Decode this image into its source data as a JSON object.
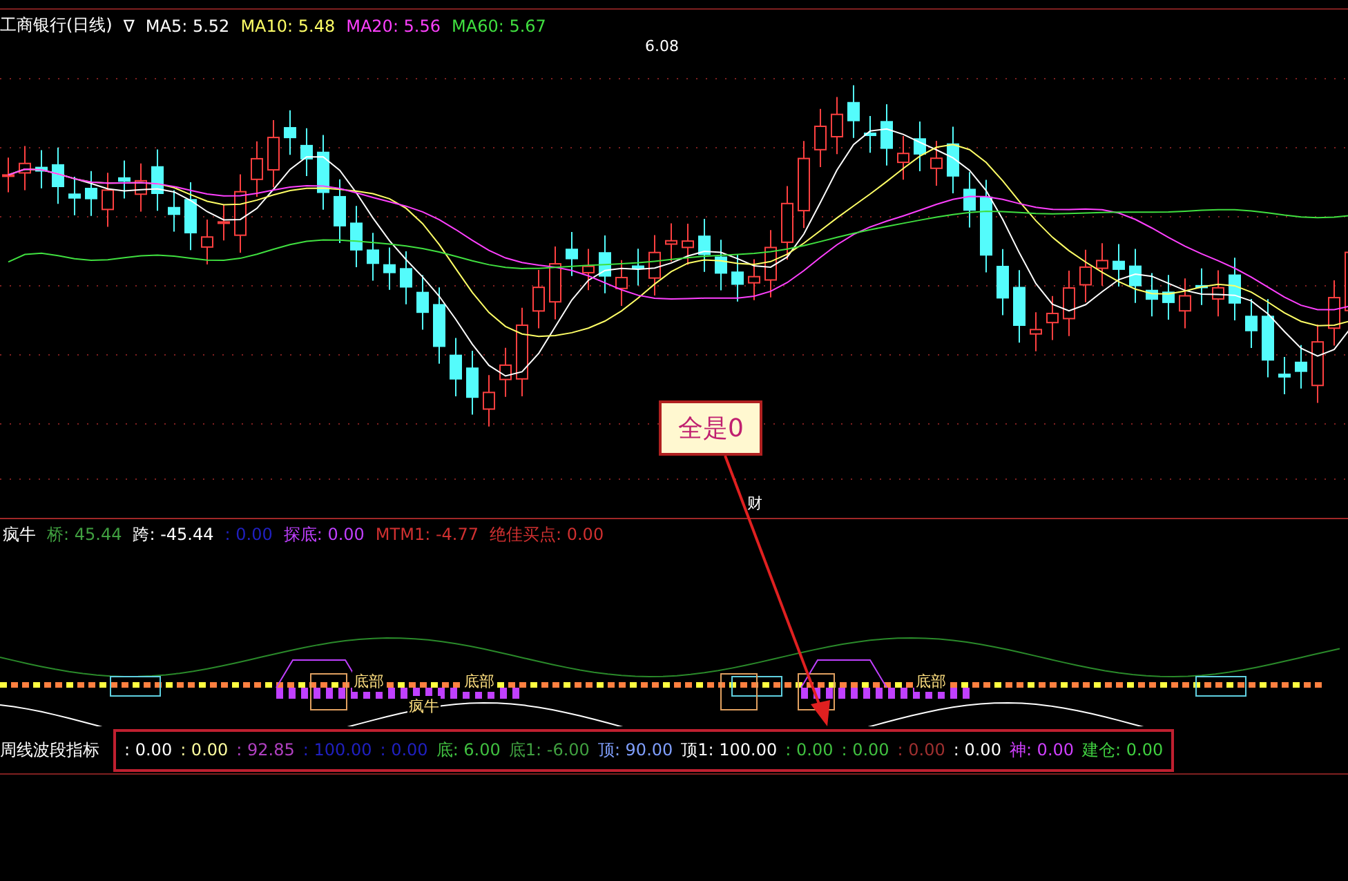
{
  "main_chart": {
    "title": "工商银行(日线)",
    "toggle": "∇",
    "legend": [
      {
        "text": "MA5: 5.52",
        "color": "#ffffff"
      },
      {
        "text": "MA10: 5.48",
        "color": "#ffff66"
      },
      {
        "text": "MA20: 5.56",
        "color": "#ff40ff"
      },
      {
        "text": "MA60: 5.67",
        "color": "#40e040"
      }
    ],
    "peak_label": "6.08",
    "event_marker": "财"
  },
  "callout": {
    "text": "全是0"
  },
  "indicator_1": {
    "title": "疯牛",
    "items": [
      {
        "text": "桥: 45.44",
        "color": "#40a040"
      },
      {
        "text": "跨: -45.44",
        "color": "#ffffff"
      },
      {
        "text": ": 0.00",
        "color": "#2020c0"
      },
      {
        "text": "探底: 0.00",
        "color": "#c040ff"
      },
      {
        "text": "MTM1: -4.77",
        "color": "#d03030"
      },
      {
        "text": "绝佳买点: 0.00",
        "color": "#d03030"
      }
    ],
    "labels": [
      "底部",
      "底部",
      "疯牛",
      "底部"
    ]
  },
  "indicator_2": {
    "title": "周线波段指标",
    "items": [
      {
        "text": ": 0.00",
        "color": "#ffffff"
      },
      {
        "text": ": 0.00",
        "color": "#ffffa0"
      },
      {
        "text": ": 92.85",
        "color": "#b040c0"
      },
      {
        "text": ": 100.00",
        "color": "#2020c0"
      },
      {
        "text": ": 0.00",
        "color": "#2020c0"
      },
      {
        "text": "底: 6.00",
        "color": "#40c040"
      },
      {
        "text": "底1: -6.00",
        "color": "#40a040"
      },
      {
        "text": "顶: 90.00",
        "color": "#80a0ff"
      },
      {
        "text": "顶1: 100.00",
        "color": "#ffffff"
      },
      {
        "text": ": 0.00",
        "color": "#40c040"
      },
      {
        "text": ": 0.00",
        "color": "#40c040"
      },
      {
        "text": ": 0.00",
        "color": "#a03030"
      },
      {
        "text": ": 0.00",
        "color": "#ffffff"
      },
      {
        "text": "神: 0.00",
        "color": "#d040ff"
      },
      {
        "text": "建仓: 0.00",
        "color": "#40d040"
      }
    ]
  }
}
